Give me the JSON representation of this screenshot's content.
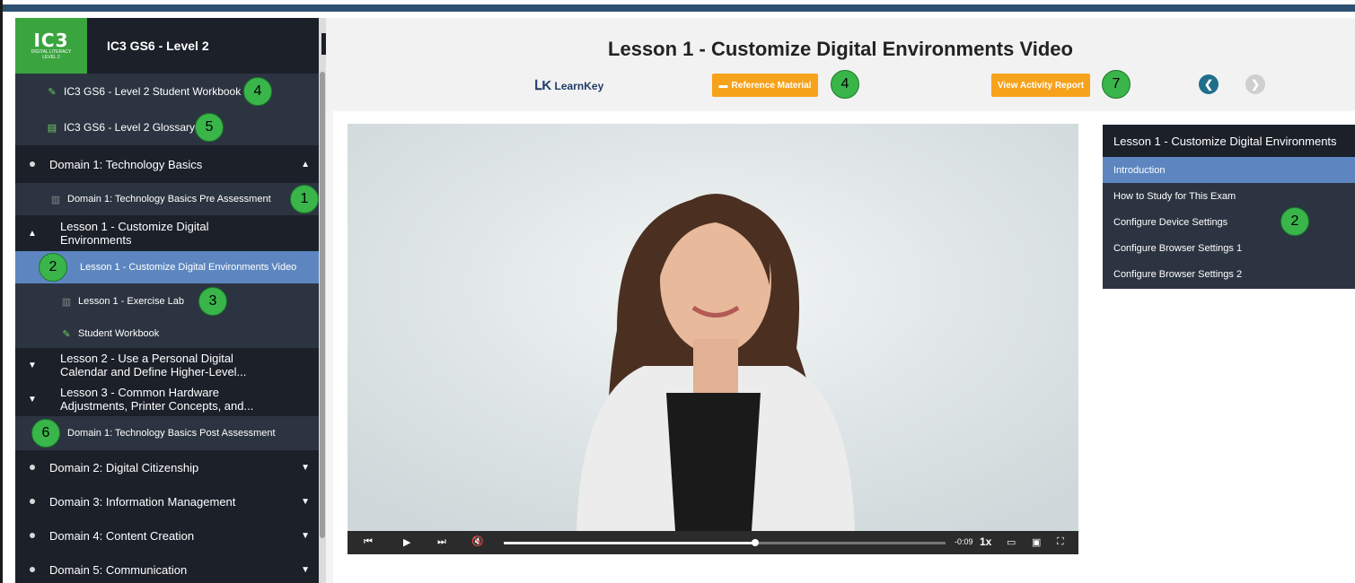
{
  "app": {
    "logo_main": "IC3",
    "logo_sub": "DIGITAL LITERACY",
    "logo_level": "LEVEL 2",
    "course_title": "IC3 GS6 - Level 2"
  },
  "sidebar": {
    "workbook": "IC3 GS6 - Level 2 Student Workbook",
    "glossary": "IC3 GS6 - Level 2 Glossary",
    "domain1": "Domain 1: Technology Basics",
    "pre_assessment": "Domain 1: Technology Basics Pre Assessment",
    "lesson1": "Lesson 1 - Customize Digital Environments",
    "lesson1_video": "Lesson 1 - Customize Digital Environments Video",
    "exercise_lab": "Lesson 1 - Exercise Lab",
    "student_workbook": "Student Workbook",
    "lesson2": "Lesson 2 - Use a Personal Digital Calendar and Define Higher-Level...",
    "lesson3": "Lesson 3 - Common Hardware Adjustments, Printer Concepts, and...",
    "post_assessment": "Domain 1: Technology Basics Post Assessment",
    "domain2": "Domain 2: Digital Citizenship",
    "domain3": "Domain 3: Information Management",
    "domain4": "Domain 4: Content Creation",
    "domain5": "Domain 5: Communication"
  },
  "badges": {
    "workbook": "4",
    "glossary": "5",
    "pre_assessment": "1",
    "video": "2",
    "exercise_lab": "3",
    "post_assessment": "6",
    "reference": "4",
    "report": "7",
    "playlist": "2"
  },
  "main": {
    "title": "Lesson 1 - Customize Digital Environments Video",
    "learnkey_logo": "LearnKey",
    "reference_button": "Reference Material",
    "report_button": "View Activity Report"
  },
  "player": {
    "time": "-0:09",
    "speed": "1x",
    "progress": 0.57
  },
  "playlist": {
    "header": "Lesson 1 - Customize Digital Environments",
    "items": [
      "Introduction",
      "How to Study for This Exam",
      "Configure Device Settings",
      "Configure Browser Settings 1",
      "Configure Browser Settings 2"
    ]
  },
  "colors": {
    "accent_green": "#39b54a",
    "orange": "#f6a21b",
    "selected_blue": "#5d86c0",
    "sidebar_dark": "#1b2029"
  }
}
